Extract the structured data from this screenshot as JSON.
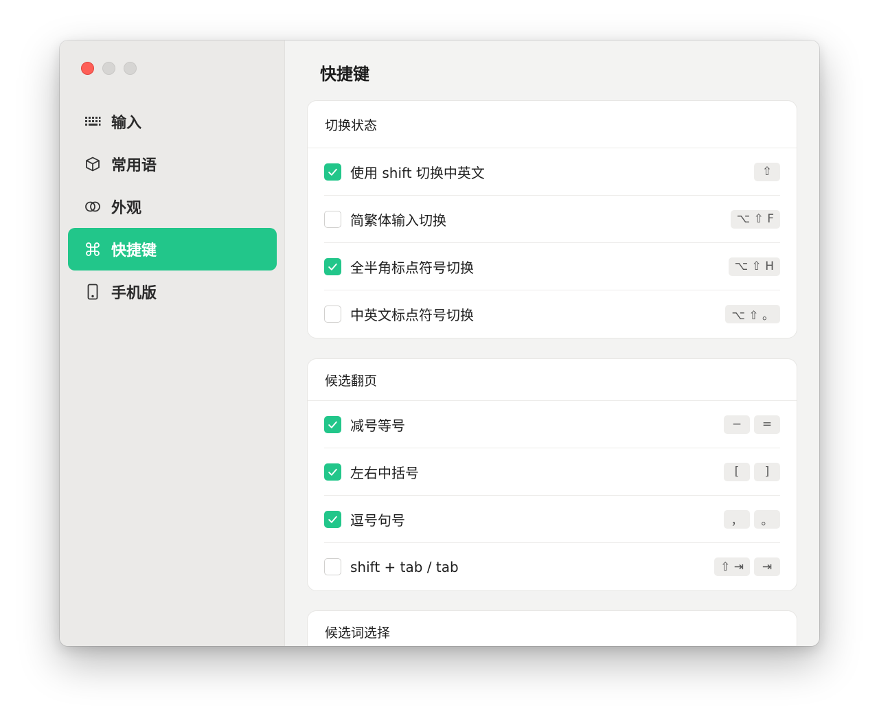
{
  "window": {
    "traffic_lights": [
      "close",
      "minimize",
      "maximize"
    ]
  },
  "sidebar": {
    "items": [
      {
        "label": "输入",
        "icon": "keyboard-icon",
        "active": false
      },
      {
        "label": "常用语",
        "icon": "cube-icon",
        "active": false
      },
      {
        "label": "外观",
        "icon": "circles-icon",
        "active": false
      },
      {
        "label": "快捷键",
        "icon": "command-icon",
        "active": true
      },
      {
        "label": "手机版",
        "icon": "phone-icon",
        "active": false
      }
    ]
  },
  "main": {
    "title": "快捷键",
    "sections": [
      {
        "header": "切换状态",
        "rows": [
          {
            "label": "使用 shift 切换中英文",
            "checked": true,
            "keys": [
              "⇧"
            ]
          },
          {
            "label": "简繁体输入切换",
            "checked": false,
            "keys": [
              "⌥ ⇧ F"
            ]
          },
          {
            "label": "全半角标点符号切换",
            "checked": true,
            "keys": [
              "⌥ ⇧ H"
            ]
          },
          {
            "label": "中英文标点符号切换",
            "checked": false,
            "keys": [
              "⌥ ⇧ 。"
            ]
          }
        ]
      },
      {
        "header": "候选翻页",
        "rows": [
          {
            "label": "减号等号",
            "checked": true,
            "keys": [
              "−",
              "="
            ]
          },
          {
            "label": "左右中括号",
            "checked": true,
            "keys": [
              "[",
              "]"
            ]
          },
          {
            "label": "逗号句号",
            "checked": true,
            "keys": [
              "，",
              "。"
            ]
          },
          {
            "label": "shift + tab / tab",
            "checked": false,
            "keys": [
              "⇧ ⇥",
              "⇥"
            ]
          }
        ]
      },
      {
        "header": "候选词选择",
        "rows": []
      }
    ]
  },
  "colors": {
    "accent": "#22c68a",
    "sidebar_bg": "#ebeae8",
    "main_bg": "#f3f3f2",
    "close": "#fe5f57"
  }
}
